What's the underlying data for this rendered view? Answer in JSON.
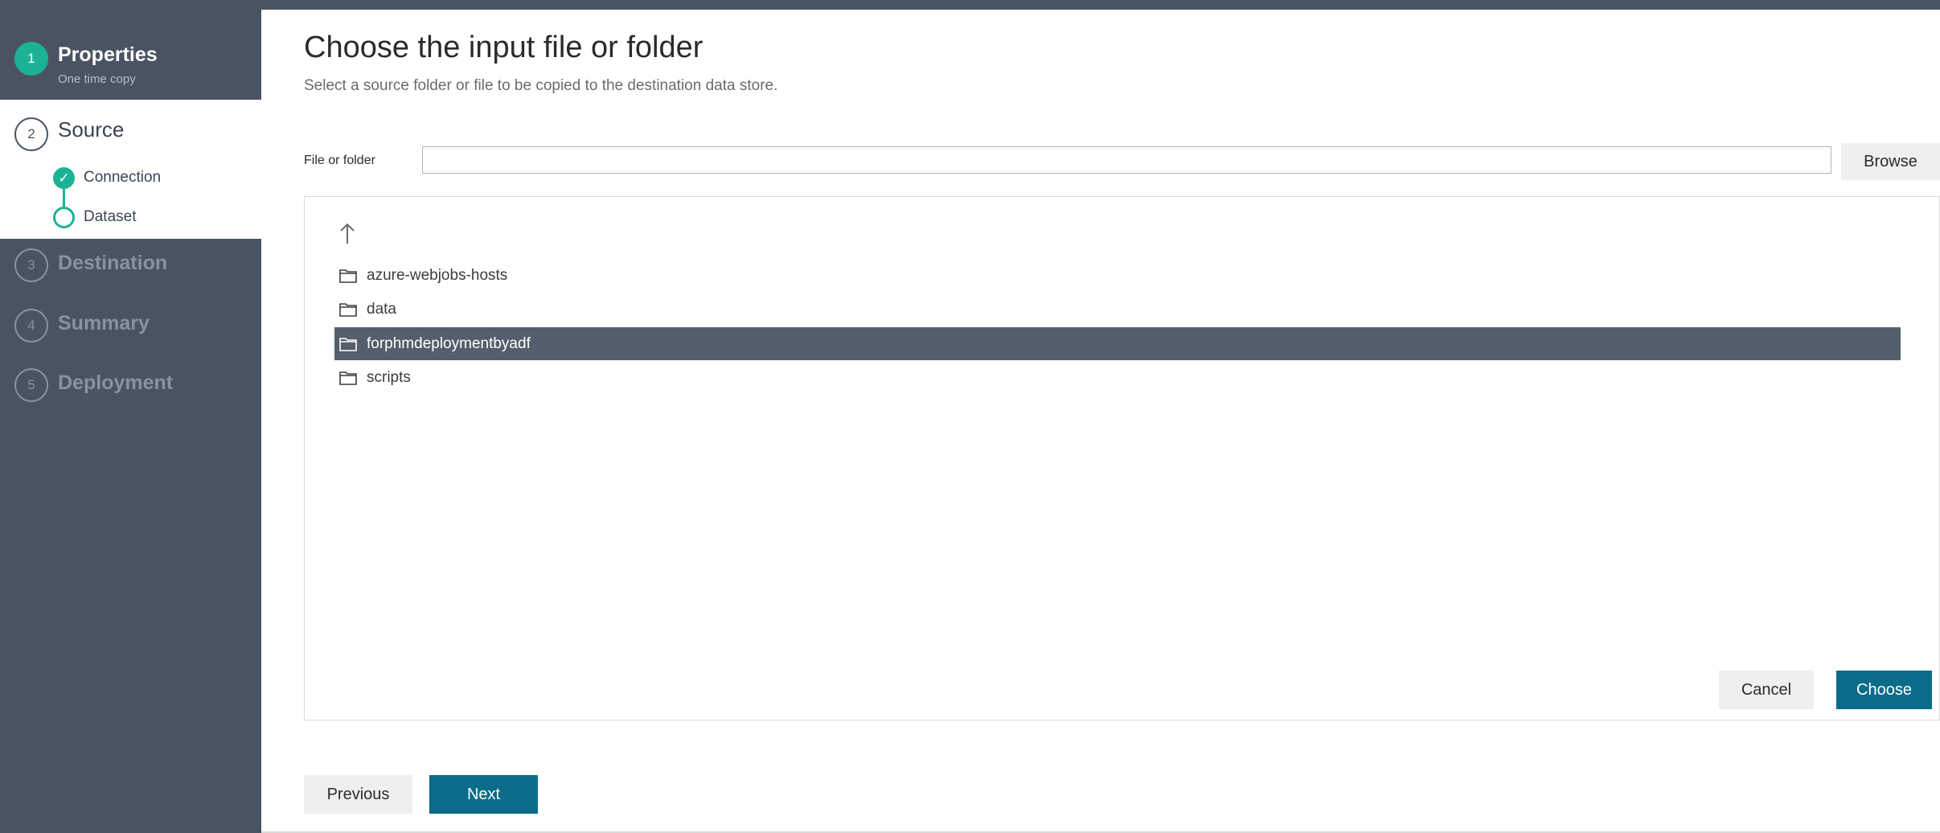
{
  "wizard": {
    "steps": [
      {
        "number": "1",
        "title": "Properties",
        "subtitle": "One time copy",
        "state": "completed"
      },
      {
        "number": "2",
        "title": "Source",
        "state": "active",
        "substeps": [
          {
            "label": "Connection",
            "state": "completed"
          },
          {
            "label": "Dataset",
            "state": "active"
          }
        ]
      },
      {
        "number": "3",
        "title": "Destination",
        "state": "pending"
      },
      {
        "number": "4",
        "title": "Summary",
        "state": "pending"
      },
      {
        "number": "5",
        "title": "Deployment",
        "state": "pending"
      }
    ]
  },
  "main": {
    "title": "Choose the input file or folder",
    "subtitle": "Select a source folder or file to be copied to the destination data store.",
    "file_field": {
      "label": "File or folder",
      "value": "",
      "placeholder": ""
    },
    "browse_label": "Browse",
    "up_icon": "arrow-up-icon",
    "folders": [
      {
        "name": "azure-webjobs-hosts",
        "icon": "folder-icon",
        "selected": false
      },
      {
        "name": "data",
        "icon": "folder-icon",
        "selected": false
      },
      {
        "name": "forphmdeploymentbyadf",
        "icon": "folder-icon",
        "selected": true
      },
      {
        "name": "scripts",
        "icon": "folder-icon",
        "selected": false
      }
    ],
    "cancel_label": "Cancel",
    "choose_label": "Choose"
  },
  "footer": {
    "previous_label": "Previous",
    "next_label": "Next"
  },
  "colors": {
    "sidebar": "#4a5361",
    "accent_green": "#1cb394",
    "primary_button": "#0a6b8a",
    "selected_row": "#545e6c"
  }
}
